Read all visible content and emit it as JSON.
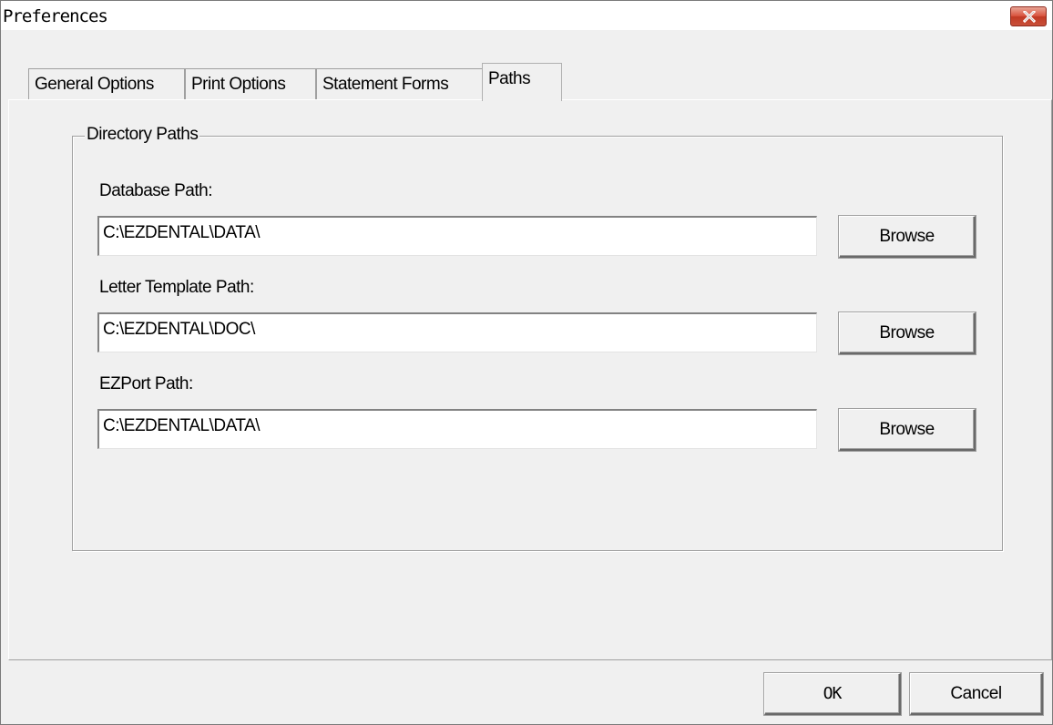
{
  "window": {
    "title": "Preferences"
  },
  "tabs": [
    {
      "label": "General Options",
      "active": false
    },
    {
      "label": "Print Options",
      "active": false
    },
    {
      "label": "Statement Forms",
      "active": false
    },
    {
      "label": "Paths",
      "active": true
    }
  ],
  "group": {
    "title": "Directory Paths"
  },
  "fields": [
    {
      "label": "Database Path:",
      "value": "C:\\EZDENTAL\\DATA\\",
      "button": "Browse"
    },
    {
      "label": "Letter Template Path:",
      "value": "C:\\EZDENTAL\\DOC\\",
      "button": "Browse"
    },
    {
      "label": "EZPort Path:",
      "value": "C:\\EZDENTAL\\DATA\\",
      "button": "Browse"
    }
  ],
  "footer": {
    "ok_label": "OK",
    "cancel_label": "Cancel"
  },
  "colors": {
    "close_button": "#d9543f",
    "dialog_bg": "#f0f0f0"
  },
  "icons": {
    "close": "close-icon"
  }
}
